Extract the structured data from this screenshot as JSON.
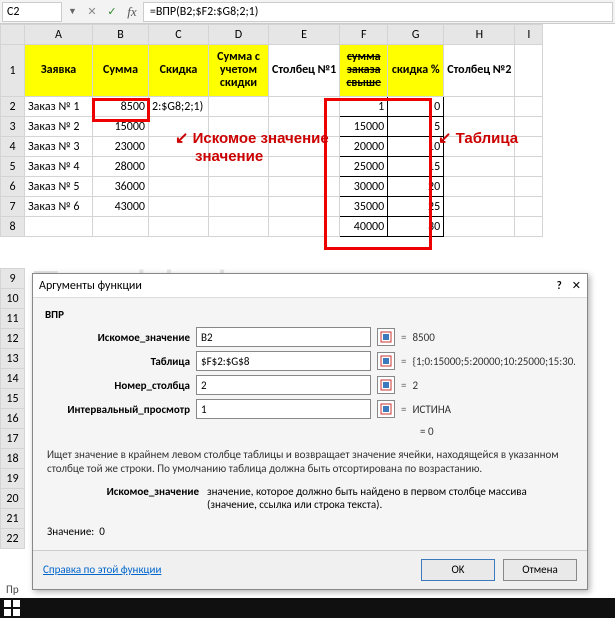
{
  "formula_bar": {
    "name_box": "C2",
    "formula": "=ВПР(B2;$F2:$G8;2;1)"
  },
  "columns": [
    "A",
    "B",
    "C",
    "D",
    "E",
    "F",
    "G",
    "H",
    "I"
  ],
  "headers": {
    "A": "Заявка",
    "B": "Сумма",
    "C": "Скидка",
    "D": "Сумма с учетом скидки",
    "E": "Столбец №1",
    "F": "сумма заказа свыше",
    "G": "скидка %",
    "H": "Столбец №2"
  },
  "data_left": [
    {
      "a": "Заказ № 1",
      "b": "8500",
      "c": "2:$G8;2;1)"
    },
    {
      "a": "Заказ № 2",
      "b": "15000",
      "c": ""
    },
    {
      "a": "Заказ № 3",
      "b": "23000",
      "c": ""
    },
    {
      "a": "Заказ № 4",
      "b": "28000",
      "c": ""
    },
    {
      "a": "Заказ № 5",
      "b": "36000",
      "c": ""
    },
    {
      "a": "Заказ № 6",
      "b": "43000",
      "c": ""
    }
  ],
  "data_right": [
    {
      "f": "1",
      "g": "0"
    },
    {
      "f": "15000",
      "g": "5"
    },
    {
      "f": "20000",
      "g": "10"
    },
    {
      "f": "25000",
      "g": "15"
    },
    {
      "f": "30000",
      "g": "20"
    },
    {
      "f": "35000",
      "g": "25"
    },
    {
      "f": "40000",
      "g": "30"
    }
  ],
  "annotations": {
    "lookup": "Искомое значение",
    "table": "Таблица"
  },
  "dialog": {
    "title": "Аргументы функции",
    "func": "ВПР",
    "args": [
      {
        "label": "Искомое_значение",
        "value": "B2",
        "result": "8500"
      },
      {
        "label": "Таблица",
        "value": "$F$2:$G$8",
        "result": "{1;0:15000;5:20000;10:25000;15:30..."
      },
      {
        "label": "Номер_столбца",
        "value": "2",
        "result": "2"
      },
      {
        "label": "Интервальный_просмотр",
        "value": "1",
        "result": "ИСТИНА"
      }
    ],
    "result_eq": "= 0",
    "desc": "Ищет значение в крайнем левом столбце таблицы и возвращает значение ячейки, находящейся в указанном столбце той же строки. По умолчанию таблица должна быть отсортирована по возрастанию.",
    "arg_desc_label": "Искомое_значение",
    "arg_desc_text": "значение, которое должно быть найдено в первом столбце массива (значение, ссылка или строка текста).",
    "value_label": "Значение:",
    "value": "0",
    "help": "Справка по этой функции",
    "ok": "OK",
    "cancel": "Отмена"
  },
  "status": "Пр",
  "watermark": "Excel-helper.ru"
}
